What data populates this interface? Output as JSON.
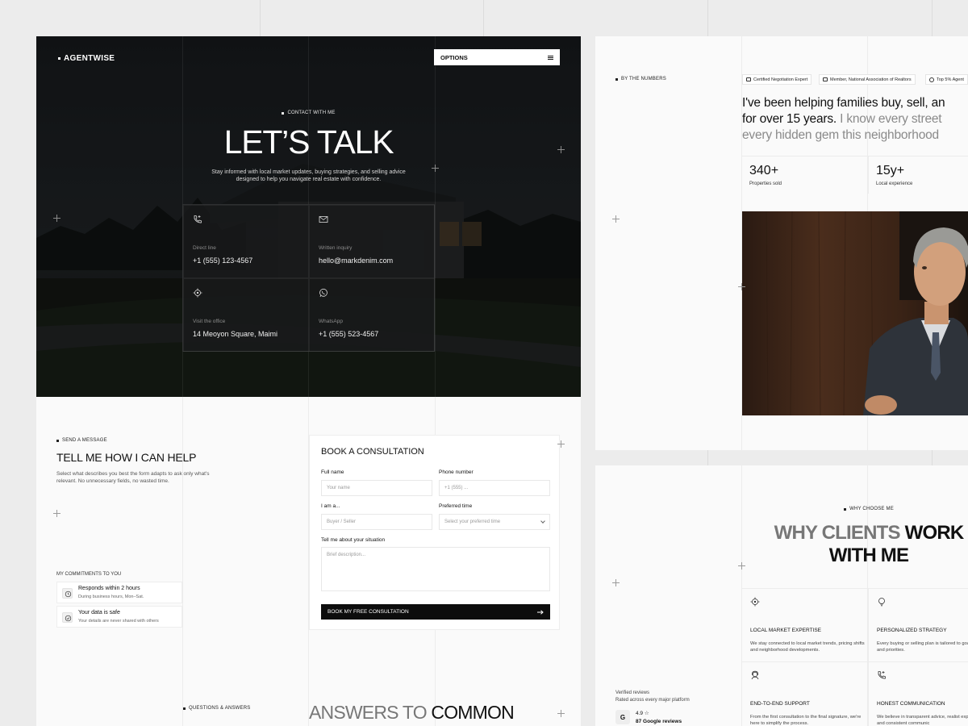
{
  "hero": {
    "logo": "AGENTWISE",
    "options_label": "OPTIONS",
    "eyebrow": "CONTACT WITH ME",
    "title": "LET’S TALK",
    "subtitle": "Stay informed with local market updates, buying strategies, and selling advice designed to help you navigate real estate with confidence.",
    "contacts": [
      {
        "label": "Direct line",
        "value": "+1 (555) 123-4567",
        "icon": "phone-icon"
      },
      {
        "label": "Written inquiry",
        "value": "hello@markdenim.com",
        "icon": "mail-icon"
      },
      {
        "label": "Visit the office",
        "value": "14 Meoyon Square, Maimi",
        "icon": "location-icon"
      },
      {
        "label": "WhatsApp",
        "value": "+1 (555) 523-4567",
        "icon": "whatsapp-icon"
      }
    ]
  },
  "message": {
    "eyebrow": "SEND A MESSAGE",
    "title": "TELL ME HOW I CAN HELP",
    "description": "Select what describes you best the form adapts to ask only what's relevant. No unnecessary fields, no wasted time.",
    "commitments_label": "MY COMMITMENTS TO YOU",
    "commitments": [
      {
        "title": "Responds within 2 hours",
        "subtitle": "During business hours, Mon–Sat."
      },
      {
        "title": "Your data is safe",
        "subtitle": "Your details are never shared with others"
      }
    ]
  },
  "form": {
    "title": "BOOK A CONSULTATION",
    "full_name_label": "Full name",
    "full_name_placeholder": "Your name",
    "phone_label": "Phone number",
    "phone_placeholder": "+1 (555) ...",
    "role_label": "I am a...",
    "role_placeholder": "Buyer / Seller",
    "time_label": "Preferred time",
    "time_placeholder": "Select your preferred time",
    "situation_label": "Tell me about your situation",
    "situation_placeholder": "Brief description...",
    "submit_label": "BOOK MY FREE CONSULTATION"
  },
  "faq": {
    "eyebrow": "QUESTIONS & ANSWERS",
    "title_grey": "ANSWERS TO",
    "title_dark": "COMMON"
  },
  "numbers": {
    "eyebrow": "BY THE NUMBERS",
    "badges": [
      "Certified Negotiation Expert",
      "Member, National Association of Realtors",
      "Top 5% Agent"
    ],
    "quote_line1": "I've been helping families buy, sell, an",
    "quote_line2_dark": "for over 15 years.",
    "quote_line2_grey": " I know every street",
    "quote_line3": "every hidden gem this neighborhood",
    "stats": [
      {
        "value": "340+",
        "label": "Properties sold"
      },
      {
        "value": "15y+",
        "label": "Local experience"
      }
    ]
  },
  "why": {
    "eyebrow": "WHY CHOOSE ME",
    "title_grey": "WHY CLIENTS",
    "title_dark": "WORK",
    "title_line2": "WITH ME",
    "features": [
      {
        "title": "LOCAL MARKET EXPERTISE",
        "desc": "We stay connected to local market trends, pricing shifts and neighborhood developments."
      },
      {
        "title": "PERSONALIZED STRATEGY",
        "desc": "Every buying or selling plan is tailored to goals, timeline, and priorities."
      },
      {
        "title": "END-TO-END SUPPORT",
        "desc": "From the first consultation to the final signature, we're here to simplify the process."
      },
      {
        "title": "HONEST COMMUNICATION",
        "desc": "We believe in transparent advice, realist expectations, and consistent communic"
      }
    ],
    "reviews_title": "Verified reviews",
    "reviews_sub": "Rated across every major platform",
    "google_letter": "G",
    "rating": "4.9 ☆",
    "rating_count": "87 Google reviews"
  }
}
